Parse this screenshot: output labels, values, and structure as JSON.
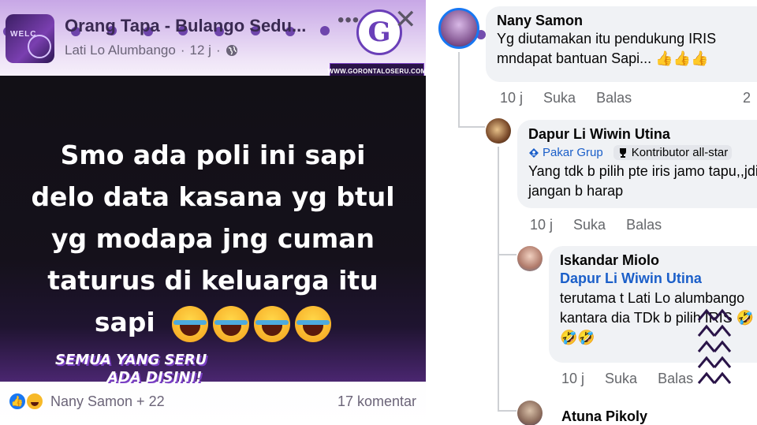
{
  "post": {
    "group_name": "Orang Tapa - Bulango Sedu...",
    "author": "Lati Lo Alumbango",
    "time": "12 j",
    "logo_letter": "G",
    "website": "WWW.GORONTALOSERU.COM",
    "avatar_text": "WELC",
    "image_text_lines": [
      "Smo ada poli ini sapi",
      "delo data kasana yg btul",
      "yg modapa jng cuman",
      "taturus di keluarga itu",
      "sapi"
    ],
    "slogan_line1": "SEMUA YANG SERU",
    "slogan_line2": "ADA DISINI!",
    "reactors": "Nany Samon + 22",
    "comment_count": "17 komentar"
  },
  "comments": [
    {
      "name": "Nany Samon",
      "text": "Yg diutamakan itu pendukung IRIS mndapat bantuan Sapi... 👍👍👍",
      "time": "10 j",
      "like": "Suka",
      "reply": "Balas",
      "reply_count": "2"
    },
    {
      "name": "Dapur Li Wiwin Utina",
      "badge1": "Pakar Grup",
      "badge2": "Kontributor all-star",
      "text": "Yang tdk b pilih pte iris jamo tapu,,jdi jangan b harap",
      "time": "10 j",
      "like": "Suka",
      "reply": "Balas"
    },
    {
      "name": "Iskandar Miolo",
      "mention": "Dapur Li Wiwin Utina",
      "text": "terutama t Lati Lo alumbango kantara dia TDk b pilih IRIS 🤣🤣🤣",
      "time": "10 j",
      "like": "Suka",
      "reply": "Balas"
    },
    {
      "name": "Atuna Pikoly"
    }
  ],
  "colors": {
    "accent_purple": "#6a3fb8",
    "facebook_blue": "#1877f2",
    "mention_blue": "#1b5fc9"
  }
}
